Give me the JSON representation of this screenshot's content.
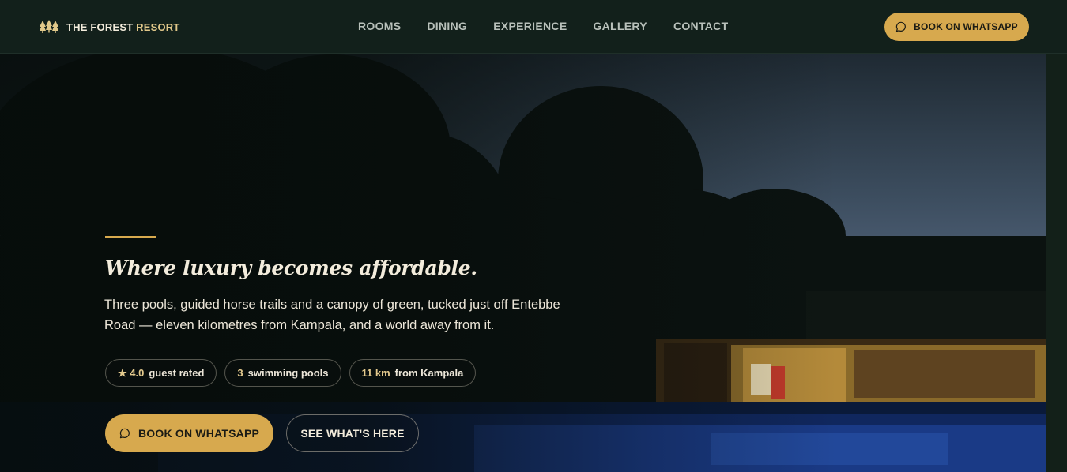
{
  "brand": {
    "name_main": "THE FOREST ",
    "name_accent": "RESORT",
    "logo_icon": "trees-icon"
  },
  "nav": {
    "links": [
      "ROOMS",
      "DINING",
      "EXPERIENCE",
      "GALLERY",
      "CONTACT"
    ],
    "cta_label": "BOOK ON WHATSAPP",
    "cta_icon": "whatsapp-chat-icon"
  },
  "hero": {
    "headline": "Where luxury becomes affordable.",
    "lede": "Three pools, guided horse trails and a canopy of green, tucked just off Entebbe Road — eleven kilometres from Kampala, and a world away from it.",
    "stats": [
      {
        "value": "★ 4.0",
        "label": "guest rated"
      },
      {
        "value": "3",
        "label": "swimming pools"
      },
      {
        "value": "11 km",
        "label": "from Kampala"
      }
    ],
    "primary_cta": "BOOK ON WHATSAPP",
    "secondary_cta": "SEE WHAT'S HERE"
  },
  "colors": {
    "accent": "#d7a94e",
    "nav_bg": "#12201b",
    "cream": "#f3ecdc"
  }
}
